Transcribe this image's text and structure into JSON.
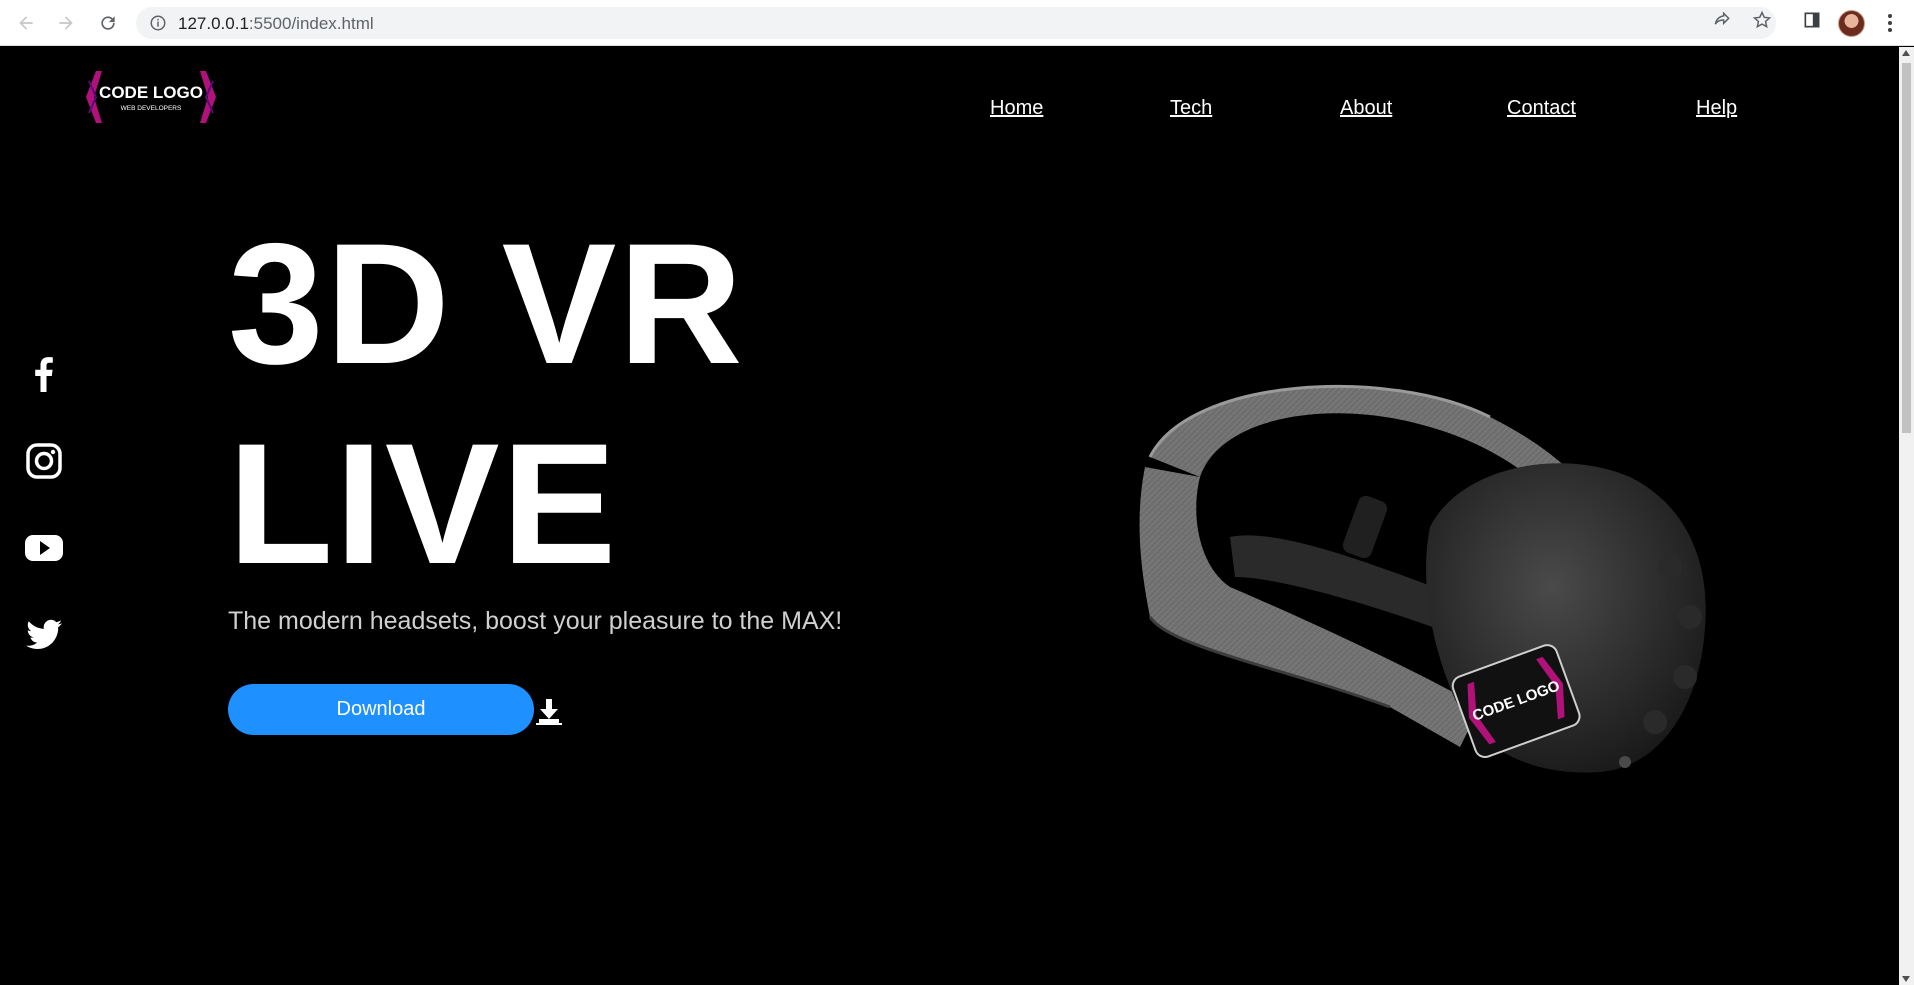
{
  "browser": {
    "url_host": "127.0.0.1",
    "url_rest": ":5500/index.html"
  },
  "site": {
    "logo": {
      "title": "CODE LOGO",
      "subtitle": "WEB DEVELOPERS"
    },
    "nav": [
      {
        "label": "Home"
      },
      {
        "label": "Tech"
      },
      {
        "label": "About"
      },
      {
        "label": "Contact"
      },
      {
        "label": "Help"
      }
    ],
    "social": [
      {
        "icon": "facebook-icon"
      },
      {
        "icon": "instagram-icon"
      },
      {
        "icon": "youtube-icon"
      },
      {
        "icon": "twitter-icon"
      }
    ],
    "hero": {
      "title_line1": "3D VR",
      "title_line2": "LIVE",
      "subtitle": "The modern headsets, boost your pleasure to the MAX!",
      "download_label": "Download"
    },
    "product_badge": "CODE LOGO"
  },
  "colors": {
    "accent": "#1e90ff",
    "logo_magenta": "#b0127a",
    "background": "#000000"
  }
}
